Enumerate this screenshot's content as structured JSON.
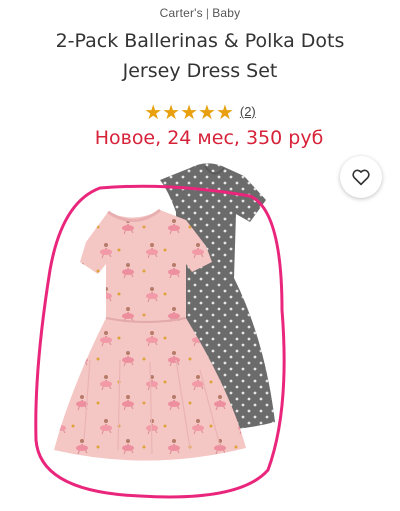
{
  "product": {
    "brand": "Carter's",
    "category": "Baby",
    "title_line1": "2-Pack Ballerinas & Polka Dots",
    "title_line2": "Jersey Dress Set",
    "stars": "★★★★★",
    "rating_value": 5,
    "review_count": "(2)",
    "overlay_note": "Новое, 24 мес, 350 руб"
  },
  "icons": {
    "favorite": "heart-outline-icon"
  },
  "colors": {
    "star": "#e8a00f",
    "note_red": "#d7233a",
    "highlight_pink": "#e9267c",
    "pink_dress": "#f4c6c4",
    "gray_dress": "#6b6b6b"
  }
}
